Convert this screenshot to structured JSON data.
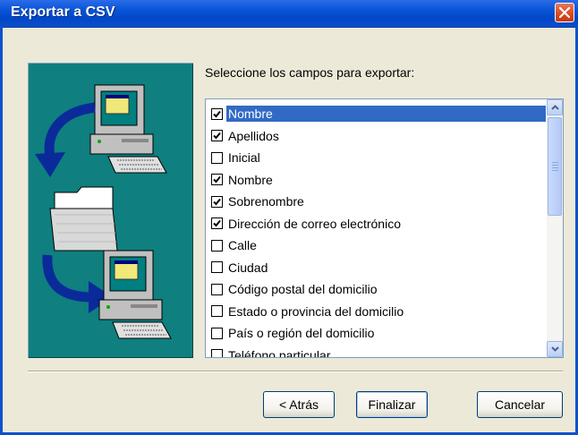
{
  "window": {
    "title": "Exportar a CSV"
  },
  "prompt": "Seleccione los campos para exportar:",
  "fields": [
    {
      "label": "Nombre",
      "checked": true,
      "selected": true
    },
    {
      "label": "Apellidos",
      "checked": true,
      "selected": false
    },
    {
      "label": "Inicial",
      "checked": false,
      "selected": false
    },
    {
      "label": "Nombre",
      "checked": true,
      "selected": false
    },
    {
      "label": "Sobrenombre",
      "checked": true,
      "selected": false
    },
    {
      "label": "Dirección de correo electrónico",
      "checked": true,
      "selected": false
    },
    {
      "label": "Calle",
      "checked": false,
      "selected": false
    },
    {
      "label": "Ciudad",
      "checked": false,
      "selected": false
    },
    {
      "label": "Código postal del domicilio",
      "checked": false,
      "selected": false
    },
    {
      "label": "Estado o provincia del domicilio",
      "checked": false,
      "selected": false
    },
    {
      "label": "País o región del domicilio",
      "checked": false,
      "selected": false
    },
    {
      "label": "Teléfono particular",
      "checked": false,
      "selected": false
    }
  ],
  "buttons": {
    "back": "< Atrás",
    "finish": "Finalizar",
    "cancel": "Cancelar"
  },
  "colors": {
    "title_bar": "#0a55d8",
    "art_bg": "#0f7f7f",
    "selection": "#316ac5"
  }
}
